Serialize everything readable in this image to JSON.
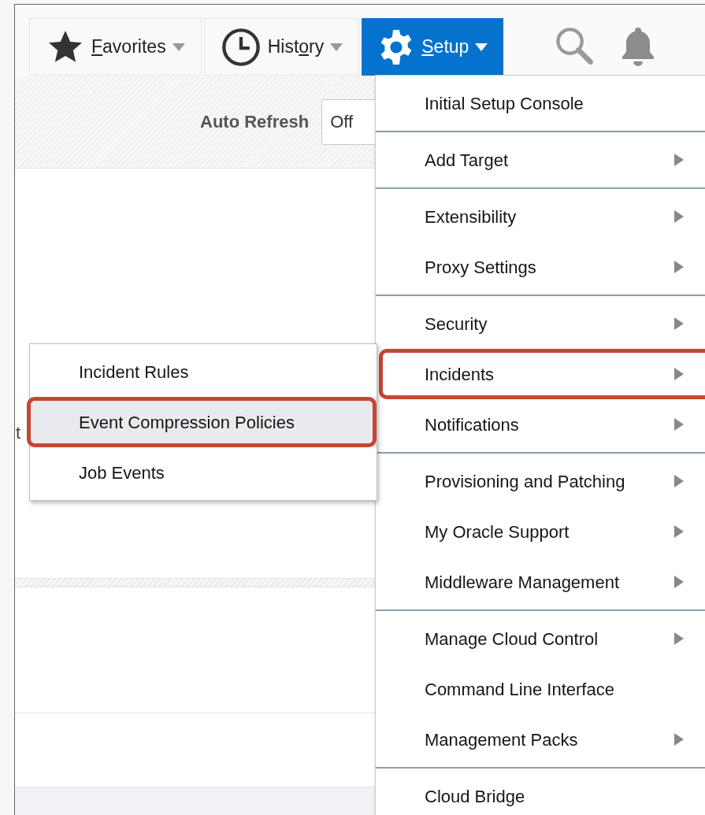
{
  "toolbar": [
    {
      "label": "Favorites",
      "selected": false
    },
    {
      "label": "History",
      "selected": false
    },
    {
      "label": "Setup",
      "selected": true
    }
  ],
  "auto_refresh": {
    "label": "Auto Refresh",
    "value": "Off"
  },
  "partial_text": "t",
  "setup_menu": {
    "groups": [
      [
        {
          "label": "Initial Setup Console",
          "has_submenu": false,
          "callout": false
        }
      ],
      [
        {
          "label": "Add Target",
          "has_submenu": true,
          "callout": false
        }
      ],
      [
        {
          "label": "Extensibility",
          "has_submenu": true,
          "callout": false
        },
        {
          "label": "Proxy Settings",
          "has_submenu": true,
          "callout": false
        }
      ],
      [
        {
          "label": "Security",
          "has_submenu": true,
          "callout": false
        },
        {
          "label": "Incidents",
          "has_submenu": true,
          "callout": true
        },
        {
          "label": "Notifications",
          "has_submenu": true,
          "callout": false
        }
      ],
      [
        {
          "label": "Provisioning and Patching",
          "has_submenu": true,
          "callout": false
        },
        {
          "label": "My Oracle Support",
          "has_submenu": true,
          "callout": false
        },
        {
          "label": "Middleware Management",
          "has_submenu": true,
          "callout": false
        }
      ],
      [
        {
          "label": "Manage Cloud Control",
          "has_submenu": true,
          "callout": false
        },
        {
          "label": "Command Line Interface",
          "has_submenu": false,
          "callout": false
        },
        {
          "label": "Management Packs",
          "has_submenu": true,
          "callout": false
        }
      ],
      [
        {
          "label": "Cloud Bridge",
          "has_submenu": false,
          "callout": false
        }
      ]
    ]
  },
  "incidents_submenu": [
    {
      "label": "Incident Rules",
      "selected": false,
      "callout": false
    },
    {
      "label": "Event Compression Policies",
      "selected": true,
      "callout": true
    },
    {
      "label": "Job Events",
      "selected": false,
      "callout": false
    }
  ]
}
